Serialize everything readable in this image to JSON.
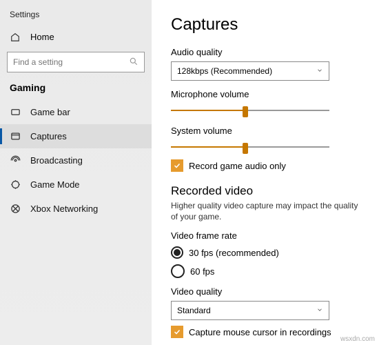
{
  "app_title": "Settings",
  "home_label": "Home",
  "search_placeholder": "Find a setting",
  "category": "Gaming",
  "sidebar": [
    {
      "id": "game-bar",
      "label": "Game bar"
    },
    {
      "id": "captures",
      "label": "Captures",
      "selected": true
    },
    {
      "id": "broadcasting",
      "label": "Broadcasting"
    },
    {
      "id": "game-mode",
      "label": "Game Mode"
    },
    {
      "id": "xbox-networking",
      "label": "Xbox Networking"
    }
  ],
  "page": {
    "title": "Captures",
    "audio_quality_label": "Audio quality",
    "audio_quality_value": "128kbps (Recommended)",
    "mic_label": "Microphone volume",
    "mic_value_pct": 47,
    "sys_label": "System volume",
    "sys_value_pct": 47,
    "record_audio_only_label": "Record game audio only",
    "record_audio_only_checked": true,
    "recorded_video_heading": "Recorded video",
    "recorded_video_note": "Higher quality video capture may impact the quality of your game.",
    "frame_rate_label": "Video frame rate",
    "frame_rate_options": [
      {
        "id": "fps30",
        "label": "30 fps (recommended)",
        "selected": true
      },
      {
        "id": "fps60",
        "label": "60 fps",
        "selected": false
      }
    ],
    "video_quality_label": "Video quality",
    "video_quality_value": "Standard",
    "capture_cursor_label": "Capture mouse cursor in recordings",
    "capture_cursor_checked": true
  },
  "watermark": "wsxdn.com"
}
